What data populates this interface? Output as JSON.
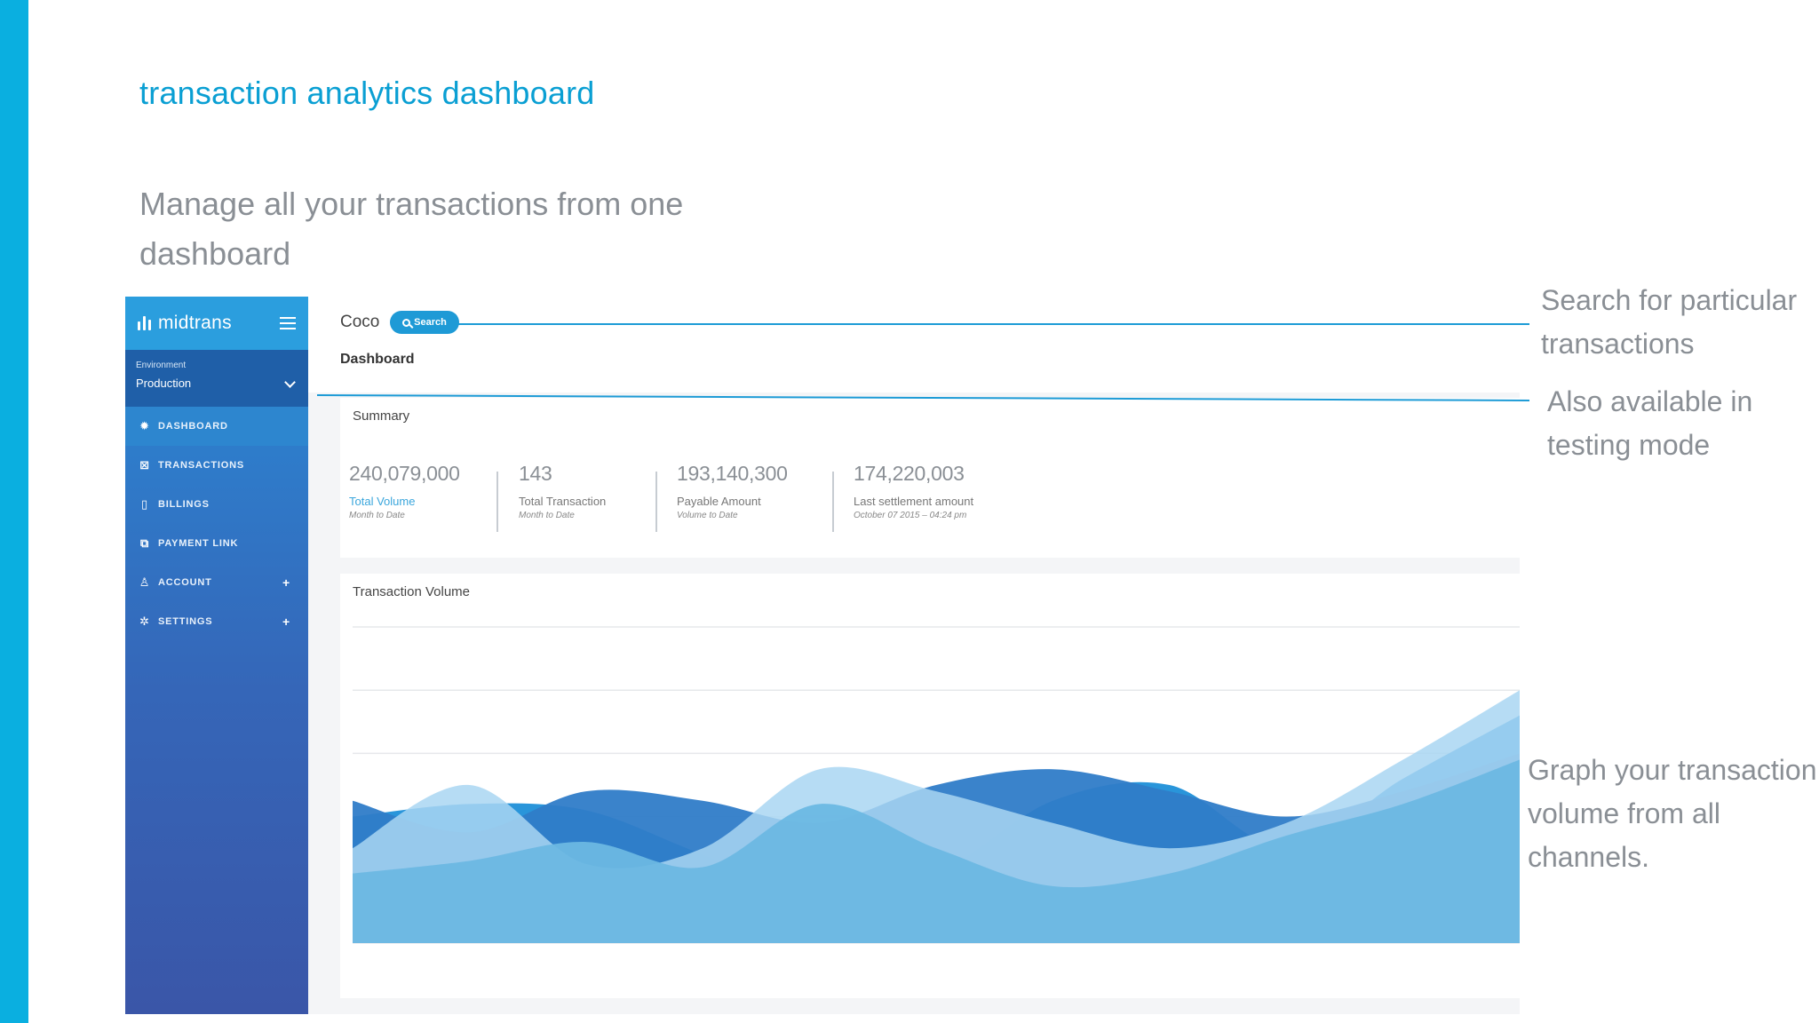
{
  "slide": {
    "title": "transaction analytics dashboard",
    "subtitle": "Manage all your transactions from one dashboard"
  },
  "sidebar": {
    "logo": "midtrans",
    "environment_label": "Environment",
    "environment_value": "Production",
    "items": [
      {
        "label": "DASHBOARD",
        "icon": "sun-icon",
        "active": true
      },
      {
        "label": "TRANSACTIONS",
        "icon": "transactions-icon",
        "active": false
      },
      {
        "label": "BILLINGS",
        "icon": "document-icon",
        "active": false
      },
      {
        "label": "PAYMENT LINK",
        "icon": "link-icon",
        "active": false
      },
      {
        "label": "ACCOUNT",
        "icon": "user-icon",
        "active": false,
        "expandable": true
      },
      {
        "label": "SETTINGS",
        "icon": "gear-icon",
        "active": false,
        "expandable": true
      }
    ]
  },
  "header": {
    "company": "Coco",
    "search_label": "Search",
    "page_title": "Dashboard"
  },
  "summary": {
    "title": "Summary",
    "stats": [
      {
        "value": "240,079,000",
        "label": "Total Volume",
        "sub": "Month to Date",
        "highlight": true
      },
      {
        "value": "143",
        "label": "Total Transaction",
        "sub": "Month to Date",
        "highlight": false
      },
      {
        "value": "193,140,300",
        "label": "Payable Amount",
        "sub": "Volume to Date",
        "highlight": false
      },
      {
        "value": "174,220,003",
        "label": "Last settlement amount",
        "sub": "October 07 2015 – 04:24 pm",
        "highlight": false
      }
    ]
  },
  "chart_data": {
    "type": "area",
    "title": "Transaction Volume",
    "xlabel": "",
    "ylabel": "",
    "grid": true,
    "x": [
      0,
      1,
      2,
      3,
      4,
      5,
      6,
      7,
      8,
      9,
      10
    ],
    "series": [
      {
        "color": "#1e8fd8",
        "values": [
          40,
          44,
          42,
          28,
          15,
          22,
          45,
          50,
          30,
          52,
          72
        ]
      },
      {
        "color": "#2f7cc8",
        "values": [
          45,
          35,
          48,
          45,
          38,
          50,
          55,
          48,
          40,
          48,
          60
        ]
      },
      {
        "color": "#a9d6f2",
        "values": [
          30,
          50,
          25,
          30,
          55,
          48,
          38,
          30,
          38,
          58,
          80
        ]
      },
      {
        "color": "#6bb8e3",
        "values": [
          22,
          26,
          32,
          24,
          44,
          30,
          18,
          22,
          34,
          44,
          58
        ]
      }
    ],
    "ylim": [
      0,
      100
    ]
  },
  "callouts": {
    "search": "Search for particular transactions",
    "testing": "Also available in testing mode",
    "graph": "Graph your transaction volume from all channels."
  },
  "colors": {
    "accent": "#0aafe0",
    "title_blue": "#0a9fd3",
    "sidebar_top": "#2b9ede",
    "sidebar_bottom": "#3a56a8"
  }
}
